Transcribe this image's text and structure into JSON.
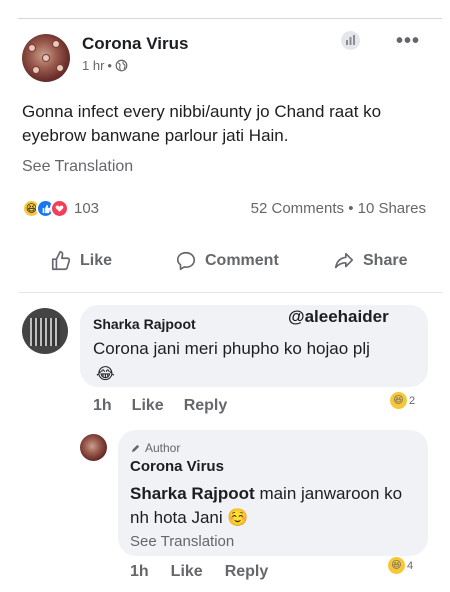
{
  "post": {
    "author": "Corona Virus",
    "time": "1 hr",
    "time_sep": "•",
    "more": "•••",
    "text": "Gonna infect every nibbi/aunty jo Chand raat ko eyebrow banwane parlour jati Hain.",
    "see_translation": "See Translation",
    "reaction_count": "103",
    "comments_shares": "52 Comments • 10 Shares",
    "icons": {
      "reactions": [
        "haha-reaction-icon",
        "like-reaction-icon",
        "love-reaction-icon"
      ],
      "privacy": "globe-icon",
      "stats": "stats-icon"
    }
  },
  "actions": {
    "like": "Like",
    "comment": "Comment",
    "share": "Share"
  },
  "comments": [
    {
      "author": "Sharka Rajpoot",
      "text": "Corona jani meri phupho ko hojao plj",
      "emoji": "😂",
      "time": "1h",
      "like": "Like",
      "reply": "Reply",
      "reaction_count": "2"
    },
    {
      "badge": "Author",
      "author": "Corona Virus",
      "mention": "Sharka Rajpoot",
      "text": "main janwaroon ko nh hota Jani",
      "emoji": "☺️",
      "see_translation": "See Translation",
      "time": "1h",
      "like": "Like",
      "reply": "Reply",
      "reaction_count": "4"
    }
  ],
  "watermark": "@aleehaider",
  "colors": {
    "primary_text": "#1c1e21",
    "secondary_text": "#65676b",
    "bubble": "#f0f2f5",
    "like_blue": "#1877f2",
    "love_red": "#f33e58",
    "haha_yellow": "#f7c73a"
  }
}
